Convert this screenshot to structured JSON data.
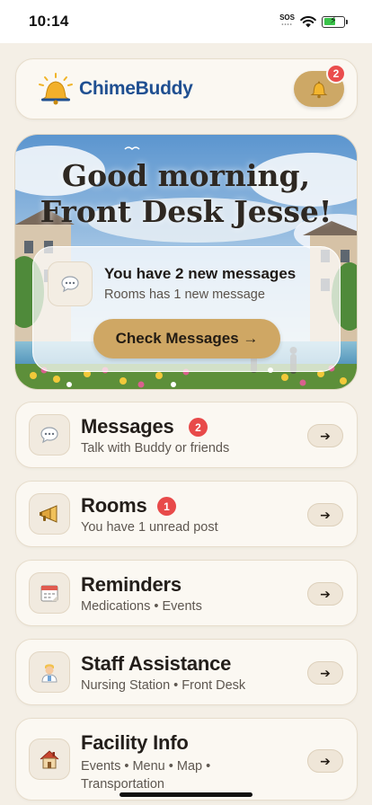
{
  "status_bar": {
    "time": "10:14",
    "sos_label": "SOS"
  },
  "header": {
    "app_name": "ChimeBuddy",
    "logo_icon": "bell-logo-icon",
    "notification_icon": "bell-icon",
    "notification_count": "2"
  },
  "hero": {
    "greeting": "Good morning, Front Desk Jesse!",
    "message_icon": "speech-bubble-icon",
    "message_title": "You have 2 new messages",
    "message_subtitle": "Rooms has 1 new message",
    "check_button_label": "Check Messages →"
  },
  "menu": [
    {
      "title": "Messages",
      "subtitle": "Talk with Buddy or friends",
      "badge": "2",
      "icon": "speech-bubble-icon",
      "arrow": "➔"
    },
    {
      "title": "Rooms",
      "subtitle": "You have 1 unread post",
      "badge": "1",
      "icon": "megaphone-icon",
      "arrow": "➔"
    },
    {
      "title": "Reminders",
      "subtitle": "Medications • Events",
      "icon": "calendar-icon",
      "arrow": "➔"
    },
    {
      "title": "Staff Assistance",
      "subtitle": "Nursing Station • Front Desk",
      "icon": "staff-person-icon",
      "arrow": "➔"
    },
    {
      "title": "Facility Info",
      "subtitle": "Events • Menu • Map • Transportation",
      "icon": "house-icon",
      "arrow": "➔"
    }
  ],
  "colors": {
    "accent_gold": "#cfa764",
    "badge_red": "#e84a4a",
    "brand_blue": "#1f4f91",
    "background": "#f4efe6"
  }
}
